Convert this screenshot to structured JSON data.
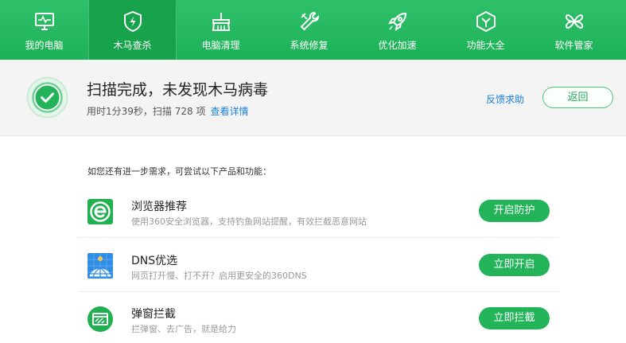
{
  "nav": {
    "items": [
      {
        "label": "我的电脑",
        "icon": "monitor-icon"
      },
      {
        "label": "木马查杀",
        "icon": "shield-bolt-icon",
        "active": true
      },
      {
        "label": "电脑清理",
        "icon": "broom-icon"
      },
      {
        "label": "系统修复",
        "icon": "wrench-icon"
      },
      {
        "label": "优化加速",
        "icon": "rocket-icon"
      },
      {
        "label": "功能大全",
        "icon": "hexagon-icon"
      },
      {
        "label": "软件管家",
        "icon": "clover-icon"
      }
    ]
  },
  "status": {
    "title": "扫描完成，未发现木马病毒",
    "summary": "用时1分39秒，扫描 728 项",
    "details_link": "查看详情",
    "feedback": "反馈求助",
    "back": "返回"
  },
  "suggestions": {
    "hint": "如您还有进一步需求，可尝试以下产品和功能：",
    "items": [
      {
        "title": "浏览器推荐",
        "desc": "使用360安全浏览器，支持钓鱼网站提醒，有效拦截恶意网站",
        "button": "开启防护",
        "icon": "browser-e-icon"
      },
      {
        "title": "DNS优选",
        "desc": "网页打开慢、打不开？启用更安全的360DNS",
        "button": "立即开启",
        "icon": "globe-grid-icon"
      },
      {
        "title": "弹窗拦截",
        "desc": "拦弹窗、去广告，就是给力",
        "button": "立即拦截",
        "icon": "popup-block-icon"
      }
    ]
  },
  "colors": {
    "brand_green": "#1db257",
    "link_blue": "#1a7fd8",
    "button_green": "#23b45a"
  }
}
